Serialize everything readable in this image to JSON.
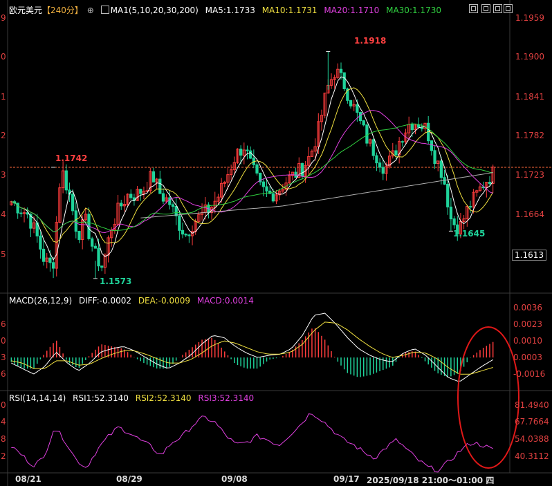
{
  "header": {
    "instrument": "欧元美元",
    "period": "【240分】",
    "add_icon": "plus-circle-icon",
    "ma_icon": "chart-icon",
    "ma_label": "MA1(5,10,20,30,200)",
    "ma5": "MA5:1.1733",
    "ma10": "MA10:1.1731",
    "ma20": "MA20:1.1710",
    "ma30": "MA30:1.1730"
  },
  "window_controls": [
    "fullscreen-icon",
    "restore-icon",
    "maximize-icon",
    "close-icon"
  ],
  "price_axis": [
    "1.1959",
    "1.1900",
    "1.1841",
    "1.1782",
    "1.1723",
    "1.1664",
    "1.1613"
  ],
  "current_price": "1.1613",
  "left_cut_price": [
    "9",
    "0",
    "1",
    "2",
    "3",
    "4",
    "5"
  ],
  "annotations": {
    "high": "1.1918",
    "ref_line": "1.1742",
    "low1": "1.1573",
    "low2": "1.1645"
  },
  "macd": {
    "label": "MACD(26,12,9)",
    "diff": "DIFF:-0.0002",
    "dea": "DEA:-0.0009",
    "macd": "MACD:0.0014",
    "axis": [
      "0.0036",
      "0.0023",
      "0.0010",
      "0.0003",
      "-0.0016"
    ],
    "left_cut": [
      "6",
      "3",
      "0",
      "3",
      "6"
    ]
  },
  "rsi": {
    "label": "RSI(14,14,14)",
    "rsi1": "RSI1:52.3140",
    "rsi2": "RSI2:52.3140",
    "rsi3": "RSI3:52.3140",
    "axis": [
      "81.4940",
      "67.7664",
      "54.0388",
      "40.3112"
    ],
    "left_cut": [
      "0",
      "4",
      "8",
      "2"
    ]
  },
  "x_axis": [
    "08/21",
    "08/29",
    "09/08",
    "09/17",
    "2025/09/18 21:00～01:00 四"
  ],
  "colors": {
    "up": "#ff3c3c",
    "down": "#1fd39a",
    "ma5": "#ffffff",
    "ma10": "#f0e040",
    "ma20": "#e040e0",
    "ma30": "#30d040",
    "ma200": "#b0b0b0",
    "ref": "#ff6a3c",
    "circle": "#e01818"
  },
  "chart_data": [
    {
      "type": "candlestick",
      "title": "欧元美元【240分】",
      "series": [
        {
          "name": "MA5",
          "last": 1.1733
        },
        {
          "name": "MA10",
          "last": 1.1731
        },
        {
          "name": "MA20",
          "last": 1.171
        },
        {
          "name": "MA30",
          "last": 1.173
        }
      ],
      "ylim": [
        1.1573,
        1.1959
      ],
      "y_ticks": [
        1.1959,
        1.19,
        1.1841,
        1.1782,
        1.1723,
        1.1664,
        1.1613
      ],
      "x_ticks": [
        "08/21",
        "08/29",
        "09/08",
        "09/17",
        "2025/09/18 21:00～01:00 四"
      ],
      "close_path": [
        1.169,
        1.168,
        1.167,
        1.164,
        1.16,
        1.159,
        1.1742,
        1.17,
        1.164,
        1.166,
        1.161,
        1.159,
        1.165,
        1.168,
        1.17,
        1.17,
        1.171,
        1.173,
        1.17,
        1.169,
        1.166,
        1.164,
        1.166,
        1.167,
        1.168,
        1.17,
        1.173,
        1.176,
        1.1775,
        1.174,
        1.171,
        1.17,
        1.1705,
        1.172,
        1.173,
        1.174,
        1.176,
        1.18,
        1.186,
        1.189,
        1.187,
        1.184,
        1.181,
        1.178,
        1.176,
        1.174,
        1.176,
        1.179,
        1.181,
        1.181,
        1.18,
        1.176,
        1.173,
        1.166,
        1.165,
        1.168,
        1.17,
        1.172,
        1.1733
      ],
      "annotations": [
        {
          "label": "1.1918",
          "type": "high"
        },
        {
          "label": "1.1742",
          "type": "reference-line"
        },
        {
          "label": "1.1573",
          "type": "low"
        },
        {
          "label": "1.1645",
          "type": "low"
        }
      ]
    },
    {
      "type": "macd",
      "title": "MACD(26,12,9)",
      "series": [
        {
          "name": "DIFF",
          "last": -0.0002,
          "values": [
            -0.0005,
            -0.001,
            -0.0015,
            -0.0008,
            0.0005,
            -0.0005,
            -0.0012,
            -0.0005,
            0.0005,
            0.0008,
            0.001,
            0.0006,
            0.0,
            -0.0006,
            -0.001,
            -0.0005,
            0.0002,
            0.0012,
            0.002,
            0.0018,
            0.001,
            0.0004,
            0.0,
            0.0002,
            0.0003,
            0.0008,
            0.002,
            0.0038,
            0.004,
            0.003,
            0.0018,
            0.0008,
            0.0002,
            -0.0002,
            -0.0004,
            0.0004,
            0.0008,
            0.0002,
            -0.0008,
            -0.0018,
            -0.0022,
            -0.0015,
            -0.0008,
            -0.0002
          ]
        },
        {
          "name": "DEA",
          "last": -0.0009,
          "values": [
            -0.0003,
            -0.0005,
            -0.001,
            -0.001,
            -0.0003,
            -0.0003,
            -0.0007,
            -0.0006,
            -0.0001,
            0.0003,
            0.0006,
            0.0006,
            0.0003,
            -0.0001,
            -0.0005,
            -0.0005,
            -0.0002,
            0.0004,
            0.0011,
            0.0015,
            0.0013,
            0.0009,
            0.0005,
            0.0003,
            0.0003,
            0.0005,
            0.0012,
            0.0024,
            0.0032,
            0.0031,
            0.0025,
            0.0017,
            0.001,
            0.0004,
            0.0,
            0.0002,
            0.0005,
            0.0004,
            -0.0001,
            -0.0009,
            -0.0015,
            -0.0015,
            -0.0012,
            -0.0009
          ]
        },
        {
          "name": "MACD",
          "last": 0.0014
        }
      ],
      "y_ticks": [
        0.0036,
        0.0023,
        0.001,
        0.0003,
        -0.0016
      ]
    },
    {
      "type": "line",
      "title": "RSI(14,14,14)",
      "series": [
        {
          "name": "RSI1",
          "last": 52.314,
          "values": [
            55,
            48,
            40,
            45,
            70,
            60,
            45,
            38,
            52,
            62,
            70,
            66,
            60,
            55,
            48,
            58,
            63,
            72,
            78,
            74,
            64,
            56,
            58,
            63,
            60,
            56,
            64,
            72,
            82,
            76,
            68,
            60,
            56,
            50,
            46,
            54,
            60,
            52,
            44,
            38,
            36,
            44,
            52,
            58,
            56,
            52
          ]
        },
        {
          "name": "RSI2",
          "last": 52.314
        },
        {
          "name": "RSI3",
          "last": 52.314
        }
      ],
      "y_ticks": [
        81.494,
        67.7664,
        54.0388,
        40.3112
      ]
    }
  ]
}
